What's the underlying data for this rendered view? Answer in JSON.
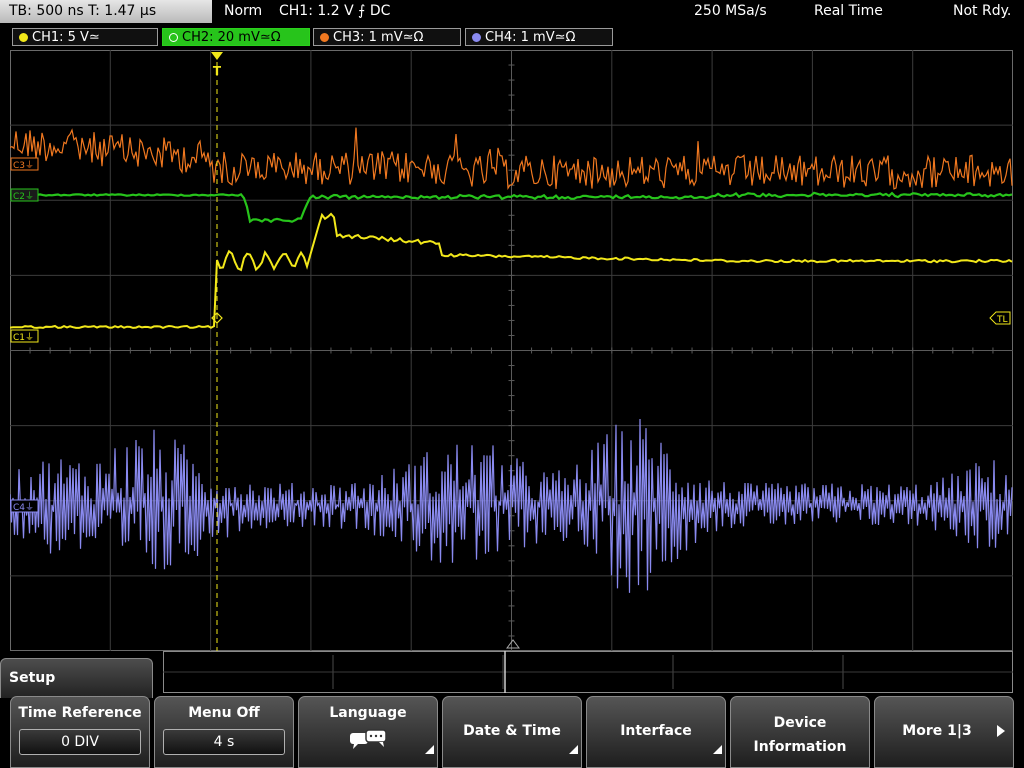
{
  "topbar": {
    "timebase": "TB: 500 ns   T: 1.47 µs",
    "trigger_mode": "Norm",
    "trigger_info": "CH1: 1.2 V ⨍ DC",
    "sample_rate": "250 MSa/s",
    "acq_mode": "Real Time",
    "status": "Not Rdy."
  },
  "channels": [
    {
      "label": "CH1: 5 V≃",
      "color": "#f2e81a",
      "active": false
    },
    {
      "label": "CH2: 20 mV≃Ω",
      "color": "#27c41b",
      "active": true
    },
    {
      "label": "CH3: 1 mV≃Ω",
      "color": "#f07820",
      "active": false
    },
    {
      "label": "CH4: 1 mV≃Ω",
      "color": "#8a8af0",
      "active": false
    }
  ],
  "markers": {
    "c3": "C3⏚",
    "c2": "C2⏚",
    "c1": "C1⏚",
    "c4": "C4⏚",
    "trigger_level": "TL",
    "trigger_pos": "T"
  },
  "setup_tab": "Setup",
  "softkeys": {
    "time_reference": {
      "title": "Time Reference",
      "value": "0 DIV"
    },
    "menu_off": {
      "title": "Menu Off",
      "value": "4 s"
    },
    "language": {
      "title": "Language",
      "icon": "speech-bubbles-icon"
    },
    "date_time": {
      "title": "Date & Time"
    },
    "interface": {
      "title": "Interface"
    },
    "device_info": {
      "line1": "Device",
      "line2": "Information"
    },
    "more": {
      "title": "More 1|3"
    }
  }
}
